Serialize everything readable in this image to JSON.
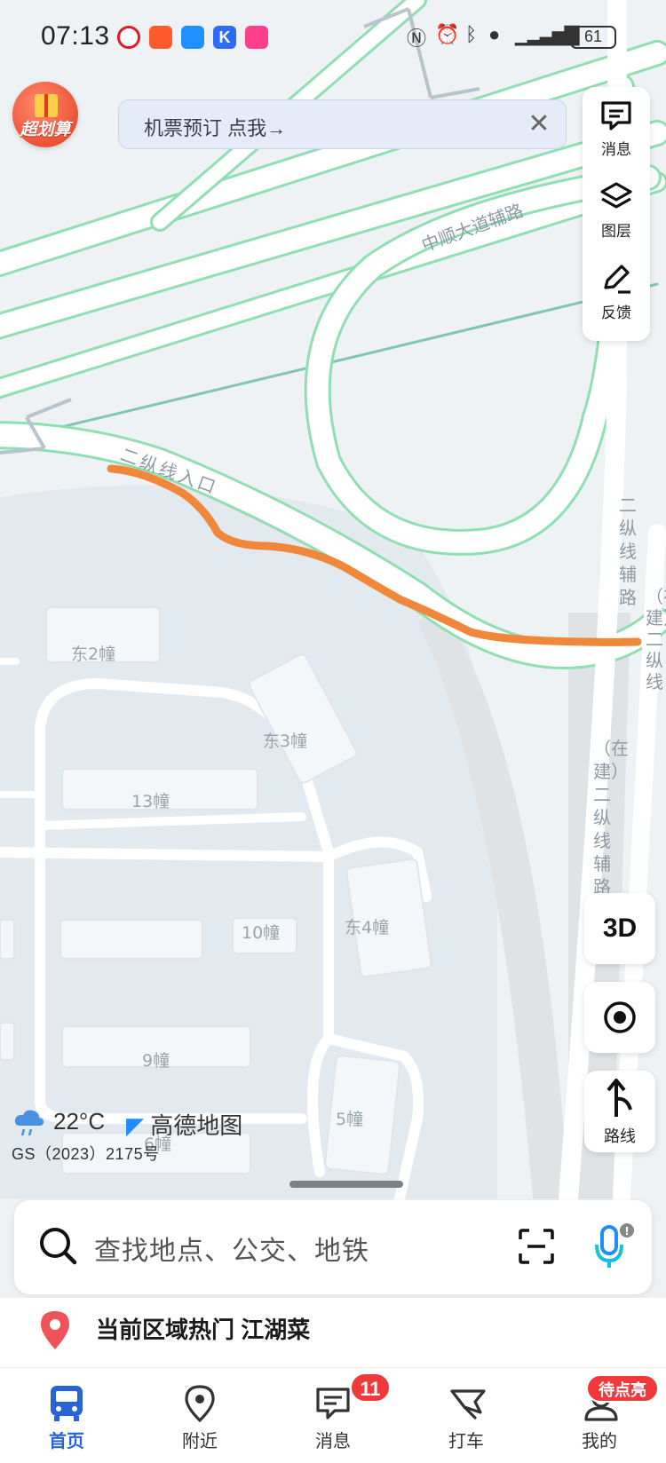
{
  "status_bar": {
    "time": "07:13",
    "battery": "61",
    "notification_icons": [
      "weibo-icon",
      "app-orange-icon",
      "chat-bubble-icon",
      "k-app-icon",
      "shop-app-icon"
    ],
    "system_icons": [
      "nfc-icon",
      "alarm-icon",
      "bluetooth-icon",
      "location-icon",
      "signal-icon"
    ]
  },
  "promo": {
    "badge_label": "超划算",
    "banner_text": "机票预订 点我→"
  },
  "right_tools": [
    {
      "label": "消息",
      "icon": "message-icon"
    },
    {
      "label": "图层",
      "icon": "layers-icon"
    },
    {
      "label": "反馈",
      "icon": "pencil-icon"
    }
  ],
  "map": {
    "road_labels": {
      "zhongshun": "中顺大道辅路",
      "entrance": "二纵线入口",
      "aux_road": "二纵线辅路",
      "under_construction_right": "（在建）二纵线",
      "under_construction_left": "（在建）二纵线辅路"
    },
    "buildings": [
      "东2幢",
      "东3幢",
      "13幢",
      "10幢",
      "东4幢",
      "9幢",
      "5幢",
      "6幢"
    ],
    "route_color": "#f0873a",
    "road_green": "#8fdfb3"
  },
  "controls": {
    "three_d": "3D",
    "route_label": "路线"
  },
  "weather": {
    "temperature": "22°C",
    "brand": "高德地图"
  },
  "license": "GS（2023）2175号",
  "search": {
    "placeholder": "查找地点、公交、地铁"
  },
  "hot": {
    "text": "当前区域热门 江湖菜"
  },
  "tabbar": {
    "tabs": [
      {
        "label": "首页",
        "icon": "bus-icon"
      },
      {
        "label": "附近",
        "icon": "location-pin-icon"
      },
      {
        "label": "消息",
        "icon": "message-icon"
      },
      {
        "label": "打车",
        "icon": "taxi-flag-icon"
      },
      {
        "label": "我的",
        "icon": "profile-icon"
      }
    ],
    "message_badge": "11",
    "profile_badge": "待点亮",
    "active_color": "#2764d6"
  }
}
